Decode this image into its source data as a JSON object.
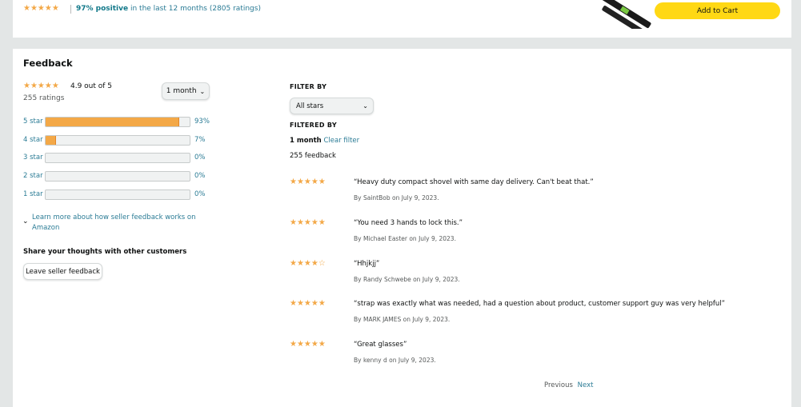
{
  "top": {
    "stars": "★★★★★",
    "positive": "97% positive",
    "summary_rest": " in the last 12 months (2805 ratings)",
    "add_to_cart": "Add to Cart"
  },
  "feedback": {
    "title": "Feedback",
    "overall_stars": "★★★★★",
    "overall_text": "4.9 out of  5",
    "ratings_count": "255 ratings",
    "period": "1 month",
    "histogram": [
      {
        "label": "5 star",
        "percent": 93,
        "percent_text": "93%"
      },
      {
        "label": "4 star",
        "percent": 7,
        "percent_text": "7%"
      },
      {
        "label": "3 star",
        "percent": 0,
        "percent_text": "0%"
      },
      {
        "label": "2 star",
        "percent": 0,
        "percent_text": "0%"
      },
      {
        "label": "1 star",
        "percent": 0,
        "percent_text": "0%"
      }
    ],
    "learn_more": "Learn more about how seller feedback works on Amazon",
    "share_title": "Share your thoughts with other customers",
    "leave_button": "Leave seller feedback"
  },
  "filter": {
    "filter_by_label": "FILTER BY",
    "star_select": "All stars",
    "filtered_by_label": "FILTERED BY",
    "active_filter": "1 month",
    "clear_filter": "Clear filter",
    "feedback_count": "255 feedback"
  },
  "reviews": [
    {
      "stars": "★★★★★",
      "rating": 5,
      "quote": "“Heavy duty compact shovel with same day delivery. Can't beat that.”",
      "by": "By SaintBob on July 9, 2023."
    },
    {
      "stars": "★★★★★",
      "rating": 5,
      "quote": "“You need 3 hands to lock this.”",
      "by": "By Michael Easter on July 9, 2023."
    },
    {
      "stars": "★★★★☆",
      "rating": 4,
      "quote": "“Hhjkjj”",
      "by": "By Randy Schwebe on July 9, 2023."
    },
    {
      "stars": "★★★★★",
      "rating": 5,
      "quote": "“strap was exactly what was needed, had a question about product, customer support guy was very helpful”",
      "by": "By MARK JAMES on July 9, 2023."
    },
    {
      "stars": "★★★★★",
      "rating": 5,
      "quote": "“Great glasses”",
      "by": "By kenny d on July 9, 2023."
    }
  ],
  "pager": {
    "previous": "Previous",
    "next": "Next"
  },
  "colors": {
    "star": "#f3a847",
    "link": "#2a7b95",
    "cart": "#ffd814"
  }
}
